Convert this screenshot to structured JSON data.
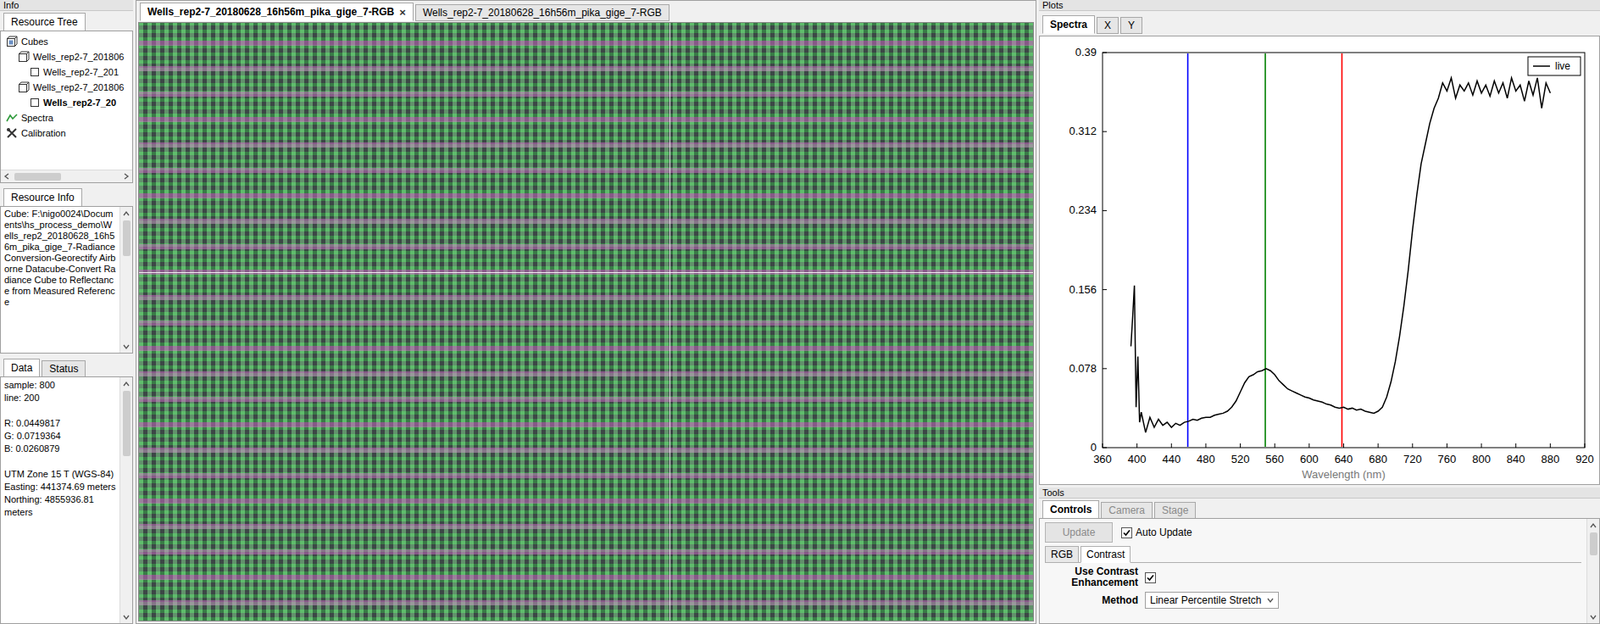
{
  "info_panel": {
    "title": "Info"
  },
  "resource_tree": {
    "tab": {
      "label": "Resource Tree",
      "selected": true
    },
    "items": [
      {
        "label": "Cubes",
        "kind": "cubes",
        "selected": false,
        "children": [
          {
            "label": "Wells_rep2-7_201806",
            "kind": "cube",
            "selected": false,
            "children": [
              {
                "label": "Wells_rep2-7_201",
                "kind": "image",
                "selected": false,
                "children": []
              }
            ]
          },
          {
            "label": "Wells_rep2-7_201806",
            "kind": "cube",
            "selected": false,
            "children": [
              {
                "label": "Wells_rep2-7_20",
                "kind": "image",
                "selected": true,
                "children": []
              }
            ]
          }
        ]
      },
      {
        "label": "Spectra",
        "kind": "spectra",
        "selected": false,
        "children": []
      },
      {
        "label": "Calibration",
        "kind": "calibration",
        "selected": false,
        "children": []
      }
    ]
  },
  "resource_info": {
    "tab": {
      "label": "Resource Info",
      "selected": true
    },
    "text": "Cube: F:\\nigo0024\\Documents\\hs_process_demo\\Wells_rep2_20180628_16h56m_pika_gige_7-Radiance Conversion-Georectify Airborne Datacube-Convert Radiance Cube to Reflectance from Measured Reference"
  },
  "data_panel": {
    "tabs": [
      {
        "label": "Data",
        "selected": true
      },
      {
        "label": "Status",
        "selected": false
      }
    ],
    "groups": [
      [
        "sample: 800",
        "line: 200"
      ],
      [
        "R: 0.0449817",
        "G: 0.0719364",
        "B: 0.0260879"
      ],
      [
        "UTM Zone 15 T (WGS-84)",
        "Easting: 441374.69 meters",
        "Northing: 4855936.81 meters"
      ]
    ]
  },
  "viewer": {
    "close_glyph": "×",
    "tabs": [
      {
        "label": "Wells_rep2-7_20180628_16h56m_pika_gige_7-RGB",
        "selected": true,
        "closable": true
      },
      {
        "label": "Wells_rep2-7_20180628_16h56m_pika_gige_7-RGB",
        "selected": false,
        "closable": false
      }
    ]
  },
  "plots": {
    "title": "Plots",
    "tabs": [
      {
        "label": "Spectra",
        "selected": true
      },
      {
        "label": "X",
        "selected": false
      },
      {
        "label": "Y",
        "selected": false
      }
    ],
    "chart": {
      "x_label": "Wavelength (nm)",
      "x_ticks": [
        "360",
        "400",
        "440",
        "480",
        "520",
        "560",
        "600",
        "640",
        "680",
        "720",
        "760",
        "800",
        "840",
        "880",
        "920"
      ],
      "y_ticks": [
        "0",
        "0.078",
        "0.156",
        "0.234",
        "0.312",
        "0.39"
      ],
      "bands": [
        {
          "name": "blue",
          "wavelength": 459,
          "color": "#0000ff"
        },
        {
          "name": "green",
          "wavelength": 549,
          "color": "#008000"
        },
        {
          "name": "red",
          "wavelength": 638,
          "color": "#ff0000"
        }
      ],
      "series": [
        {
          "name": "live",
          "color": "#000000",
          "wavelengths": [
            393,
            395,
            397,
            399,
            401,
            403,
            405,
            410,
            415,
            420,
            425,
            430,
            435,
            440,
            445,
            450,
            455,
            460,
            465,
            470,
            475,
            480,
            485,
            490,
            495,
            500,
            505,
            510,
            515,
            520,
            525,
            530,
            535,
            540,
            545,
            550,
            555,
            560,
            565,
            570,
            575,
            580,
            585,
            590,
            595,
            600,
            605,
            610,
            615,
            620,
            625,
            630,
            635,
            640,
            645,
            650,
            655,
            660,
            665,
            670,
            675,
            680,
            685,
            690,
            695,
            700,
            705,
            710,
            715,
            720,
            725,
            730,
            735,
            740,
            745,
            750,
            755,
            760,
            765,
            770,
            775,
            780,
            785,
            790,
            795,
            800,
            805,
            810,
            815,
            820,
            825,
            830,
            835,
            840,
            845,
            850,
            855,
            860,
            865,
            870,
            875,
            880
          ],
          "values": [
            0.1,
            0.13,
            0.16,
            0.04,
            0.09,
            0.025,
            0.035,
            0.015,
            0.03,
            0.02,
            0.028,
            0.022,
            0.025,
            0.02,
            0.024,
            0.022,
            0.025,
            0.026,
            0.028,
            0.027,
            0.029,
            0.03,
            0.03,
            0.032,
            0.033,
            0.034,
            0.036,
            0.04,
            0.046,
            0.055,
            0.064,
            0.07,
            0.072,
            0.075,
            0.076,
            0.078,
            0.076,
            0.072,
            0.066,
            0.062,
            0.058,
            0.056,
            0.054,
            0.052,
            0.05,
            0.049,
            0.047,
            0.046,
            0.045,
            0.043,
            0.042,
            0.04,
            0.039,
            0.04,
            0.038,
            0.039,
            0.037,
            0.038,
            0.036,
            0.035,
            0.034,
            0.036,
            0.04,
            0.05,
            0.065,
            0.085,
            0.11,
            0.14,
            0.175,
            0.215,
            0.25,
            0.28,
            0.3,
            0.32,
            0.335,
            0.345,
            0.36,
            0.352,
            0.365,
            0.345,
            0.358,
            0.352,
            0.36,
            0.348,
            0.362,
            0.35,
            0.358,
            0.347,
            0.362,
            0.35,
            0.36,
            0.345,
            0.365,
            0.352,
            0.358,
            0.342,
            0.362,
            0.348,
            0.365,
            0.335,
            0.36,
            0.35
          ]
        }
      ]
    }
  },
  "tools": {
    "title": "Tools",
    "tabs": [
      {
        "label": "Controls",
        "selected": true,
        "disabled": false
      },
      {
        "label": "Camera",
        "selected": false,
        "disabled": true
      },
      {
        "label": "Stage",
        "selected": false,
        "disabled": true
      }
    ],
    "update_button": {
      "label": "Update",
      "disabled": true
    },
    "auto_update": {
      "label": "Auto Update",
      "checked": true
    },
    "sub_tabs": [
      {
        "label": "RGB",
        "selected": false
      },
      {
        "label": "Contrast",
        "selected": true
      }
    ],
    "contrast": {
      "label": "Use Contrast Enhancement",
      "checked": true
    },
    "method": {
      "label": "Method",
      "value": "Linear Percentile Stretch"
    }
  }
}
